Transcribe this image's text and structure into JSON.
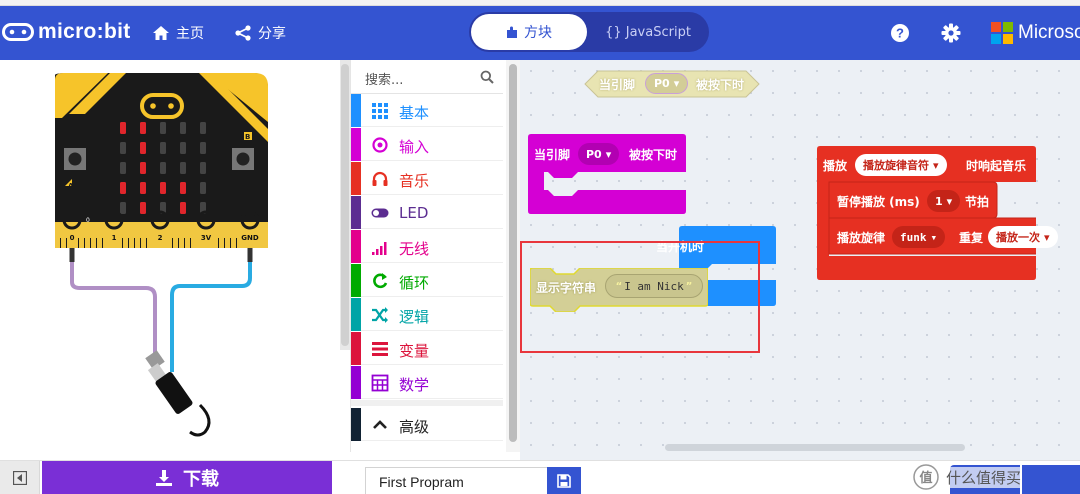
{
  "header": {
    "logo_text": "micro:bit",
    "home_label": "主页",
    "share_label": "分享",
    "blocks_tab": "方块",
    "js_tab": "{} JavaScript",
    "ms_text": "Microso"
  },
  "toolbox": {
    "search_placeholder": "搜索...",
    "categories": [
      {
        "label": "基本",
        "color": "#1e90ff",
        "icon": "grid-icon"
      },
      {
        "label": "输入",
        "color": "#d400d4",
        "icon": "target-icon"
      },
      {
        "label": "音乐",
        "color": "#e63022",
        "icon": "headphones-icon"
      },
      {
        "label": "LED",
        "color": "#5c2d91",
        "icon": "toggle-icon"
      },
      {
        "label": "无线",
        "color": "#e3008c",
        "icon": "signal-icon"
      },
      {
        "label": "循环",
        "color": "#00aa00",
        "icon": "loop-icon"
      },
      {
        "label": "逻辑",
        "color": "#00a4a6",
        "icon": "shuffle-icon"
      },
      {
        "label": "变量",
        "color": "#dc143c",
        "icon": "list-icon"
      },
      {
        "label": "数学",
        "color": "#9400d3",
        "icon": "calculator-icon"
      },
      {
        "label": "高级",
        "color": "#222222",
        "icon": "chevron-up-icon"
      }
    ]
  },
  "simulator": {
    "pins": [
      "0",
      "1",
      "2",
      "3V",
      "GND"
    ],
    "button_a": "A",
    "button_b": "B",
    "pin0_small": "0"
  },
  "workspace": {
    "ghost_block": {
      "prefix": "当引脚",
      "pin": "P0",
      "suffix": "被按下时"
    },
    "pin_event": {
      "prefix": "当引脚",
      "pin": "P0",
      "suffix": "被按下时"
    },
    "on_start": {
      "label": "当开机时"
    },
    "show_string": {
      "label": "显示字符串",
      "value": "I am Nick"
    },
    "music": {
      "play_prefix": "播放",
      "melody": "播放旋律音符",
      "play_suffix": "时响起音乐",
      "pause_label": "暂停播放 (ms)",
      "beats": "1",
      "beats_suffix": "节拍",
      "melody_label": "播放旋律",
      "melody_name": "funk",
      "repeat_label": "重复",
      "repeat_option": "播放一次"
    }
  },
  "footer": {
    "download_label": "下载",
    "project_name": "First Propram",
    "watermark": "什么值得买"
  }
}
